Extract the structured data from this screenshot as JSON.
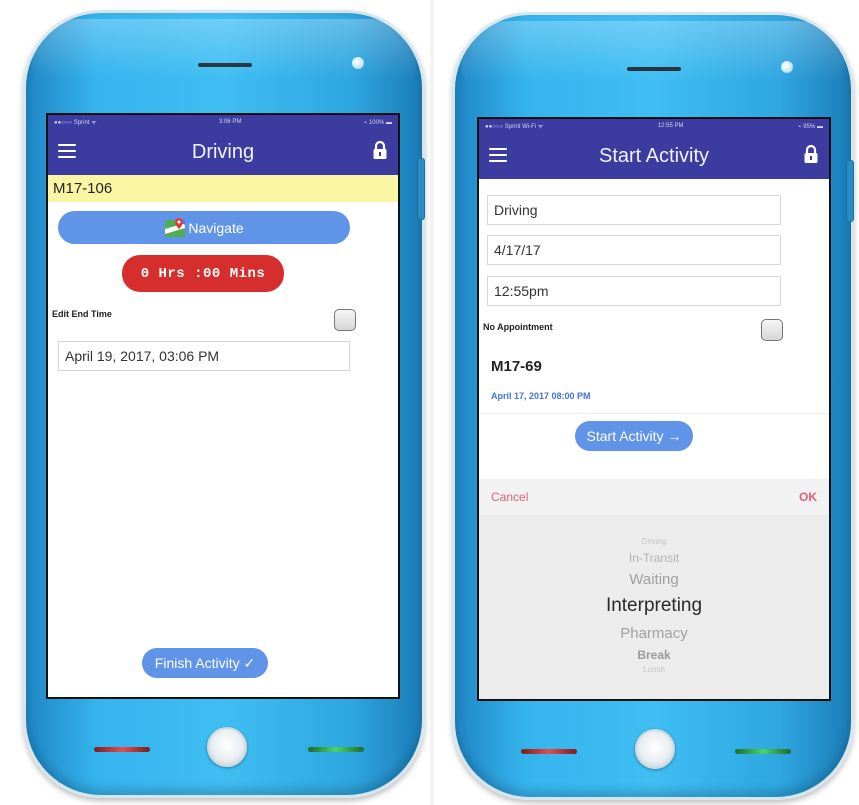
{
  "left_phone": {
    "status": {
      "carrier": "●●○○○ Sprint ᯤ",
      "time": "3:06 PM",
      "battery": "⌁ 100% ▬"
    },
    "nav": {
      "title": "Driving",
      "menu_icon": "hamburger-menu-icon",
      "lock_icon": "lock-icon"
    },
    "case_id": "M17-106",
    "navigate_label": "Navigate",
    "navigate_icon": "google-maps-icon",
    "timer": "0 Hrs :00 Mins",
    "edit_end_time_label": "Edit End Time",
    "end_time_value": "April 19, 2017, 03:06 PM",
    "finish_label": "Finish Activity ✓"
  },
  "right_phone": {
    "status": {
      "carrier": "●●○○○ Sprint Wi-Fi ᯤ",
      "time": "12:55 PM",
      "battery": "⌁ 95% ▬"
    },
    "nav": {
      "title": "Start Activity",
      "menu_icon": "hamburger-menu-icon",
      "lock_icon": "lock-icon"
    },
    "activity_field": "Driving",
    "date_field": "4/17/17",
    "time_field": "12:55pm",
    "no_appointment_label": "No Appointment",
    "appointment_id": "M17-69",
    "appointment_date": "April 17, 2017 08:00 PM",
    "start_label": "Start Activity →",
    "picker": {
      "cancel": "Cancel",
      "ok": "OK",
      "options": [
        "Driving",
        "In-Transit",
        "Waiting",
        "Interpreting",
        "Pharmacy",
        "Break",
        "Lunch"
      ],
      "selected": "Interpreting"
    }
  },
  "colors": {
    "nav_bar": "#3c3ba0",
    "phone_body": "#3fbef3",
    "case_bar": "#fbf6a3",
    "timer": "#d62d2d",
    "button": "#5f94e8",
    "picker_action": "#e0607a"
  }
}
